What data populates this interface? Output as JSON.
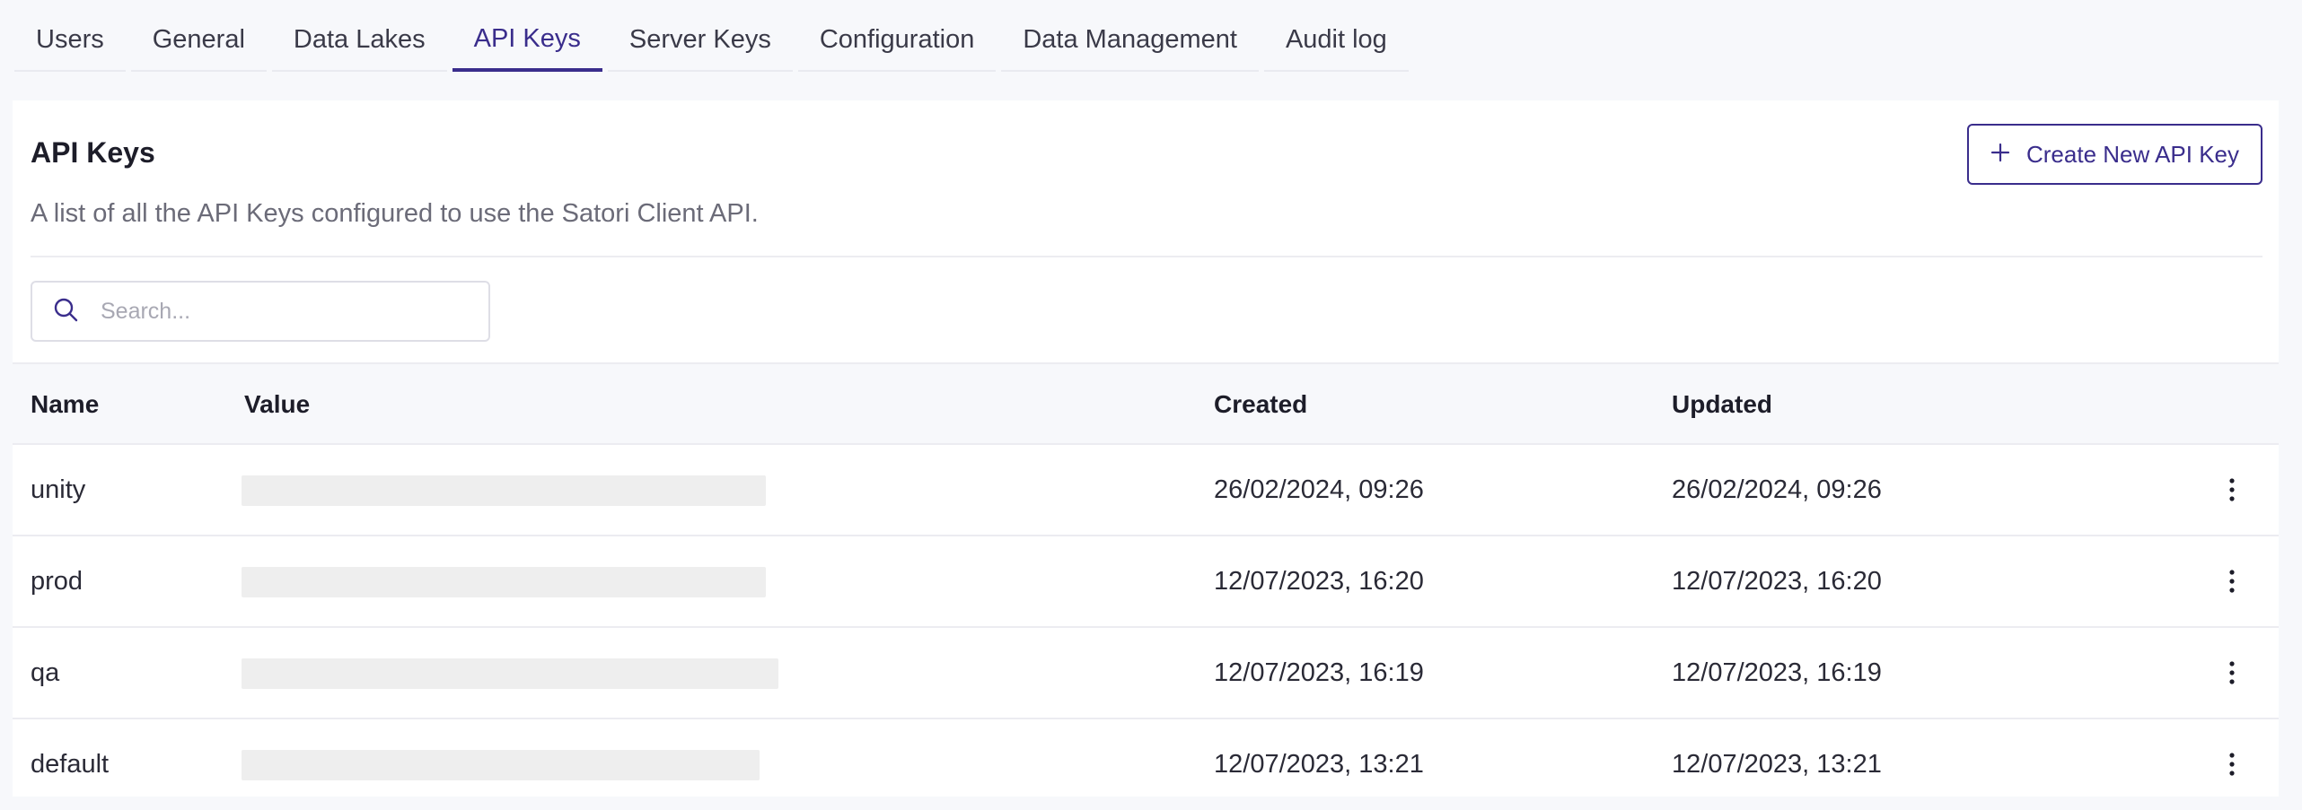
{
  "tabs": [
    {
      "label": "Users",
      "active": false
    },
    {
      "label": "General",
      "active": false
    },
    {
      "label": "Data Lakes",
      "active": false
    },
    {
      "label": "API Keys",
      "active": true
    },
    {
      "label": "Server Keys",
      "active": false
    },
    {
      "label": "Configuration",
      "active": false
    },
    {
      "label": "Data Management",
      "active": false
    },
    {
      "label": "Audit log",
      "active": false
    }
  ],
  "page": {
    "title": "API Keys",
    "description": "A list of all the API Keys configured to use the Satori Client API.",
    "create_button_label": "Create New API Key"
  },
  "search": {
    "placeholder": "Search...",
    "value": ""
  },
  "table": {
    "columns": {
      "name": "Name",
      "value": "Value",
      "created": "Created",
      "updated": "Updated"
    },
    "rows": [
      {
        "name": "unity",
        "created": "26/02/2024, 09:26",
        "updated": "26/02/2024, 09:26"
      },
      {
        "name": "prod",
        "created": "12/07/2023, 16:20",
        "updated": "12/07/2023, 16:20"
      },
      {
        "name": "qa",
        "created": "12/07/2023, 16:19",
        "updated": "12/07/2023, 16:19"
      },
      {
        "name": "default",
        "created": "12/07/2023, 13:21",
        "updated": "12/07/2023, 13:21"
      }
    ]
  },
  "colors": {
    "accent": "#3a2d8c",
    "redacted": "#eeeeee"
  },
  "icons": {
    "search": "search-icon",
    "plus": "plus-icon",
    "row_menu": "kebab-menu-icon"
  }
}
